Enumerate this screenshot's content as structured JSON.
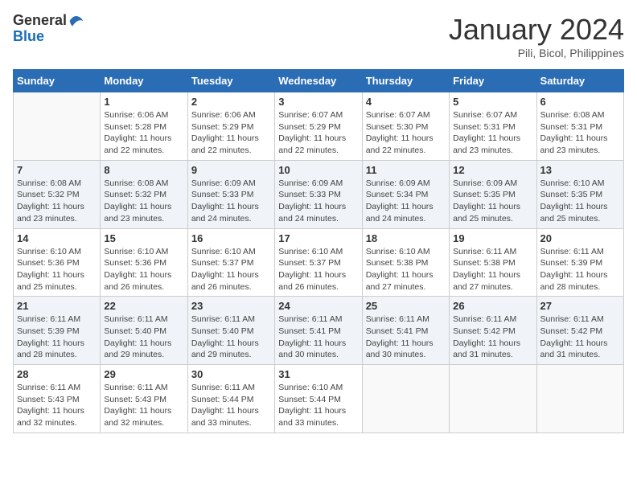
{
  "logo": {
    "general": "General",
    "blue": "Blue"
  },
  "title": "January 2024",
  "subtitle": "Pili, Bicol, Philippines",
  "days_of_week": [
    "Sunday",
    "Monday",
    "Tuesday",
    "Wednesday",
    "Thursday",
    "Friday",
    "Saturday"
  ],
  "weeks": [
    [
      {
        "day": "",
        "info": ""
      },
      {
        "day": "1",
        "info": "Sunrise: 6:06 AM\nSunset: 5:28 PM\nDaylight: 11 hours and 22 minutes."
      },
      {
        "day": "2",
        "info": "Sunrise: 6:06 AM\nSunset: 5:29 PM\nDaylight: 11 hours and 22 minutes."
      },
      {
        "day": "3",
        "info": "Sunrise: 6:07 AM\nSunset: 5:29 PM\nDaylight: 11 hours and 22 minutes."
      },
      {
        "day": "4",
        "info": "Sunrise: 6:07 AM\nSunset: 5:30 PM\nDaylight: 11 hours and 22 minutes."
      },
      {
        "day": "5",
        "info": "Sunrise: 6:07 AM\nSunset: 5:31 PM\nDaylight: 11 hours and 23 minutes."
      },
      {
        "day": "6",
        "info": "Sunrise: 6:08 AM\nSunset: 5:31 PM\nDaylight: 11 hours and 23 minutes."
      }
    ],
    [
      {
        "day": "7",
        "info": "Sunrise: 6:08 AM\nSunset: 5:32 PM\nDaylight: 11 hours and 23 minutes."
      },
      {
        "day": "8",
        "info": "Sunrise: 6:08 AM\nSunset: 5:32 PM\nDaylight: 11 hours and 23 minutes."
      },
      {
        "day": "9",
        "info": "Sunrise: 6:09 AM\nSunset: 5:33 PM\nDaylight: 11 hours and 24 minutes."
      },
      {
        "day": "10",
        "info": "Sunrise: 6:09 AM\nSunset: 5:33 PM\nDaylight: 11 hours and 24 minutes."
      },
      {
        "day": "11",
        "info": "Sunrise: 6:09 AM\nSunset: 5:34 PM\nDaylight: 11 hours and 24 minutes."
      },
      {
        "day": "12",
        "info": "Sunrise: 6:09 AM\nSunset: 5:35 PM\nDaylight: 11 hours and 25 minutes."
      },
      {
        "day": "13",
        "info": "Sunrise: 6:10 AM\nSunset: 5:35 PM\nDaylight: 11 hours and 25 minutes."
      }
    ],
    [
      {
        "day": "14",
        "info": "Sunrise: 6:10 AM\nSunset: 5:36 PM\nDaylight: 11 hours and 25 minutes."
      },
      {
        "day": "15",
        "info": "Sunrise: 6:10 AM\nSunset: 5:36 PM\nDaylight: 11 hours and 26 minutes."
      },
      {
        "day": "16",
        "info": "Sunrise: 6:10 AM\nSunset: 5:37 PM\nDaylight: 11 hours and 26 minutes."
      },
      {
        "day": "17",
        "info": "Sunrise: 6:10 AM\nSunset: 5:37 PM\nDaylight: 11 hours and 26 minutes."
      },
      {
        "day": "18",
        "info": "Sunrise: 6:10 AM\nSunset: 5:38 PM\nDaylight: 11 hours and 27 minutes."
      },
      {
        "day": "19",
        "info": "Sunrise: 6:11 AM\nSunset: 5:38 PM\nDaylight: 11 hours and 27 minutes."
      },
      {
        "day": "20",
        "info": "Sunrise: 6:11 AM\nSunset: 5:39 PM\nDaylight: 11 hours and 28 minutes."
      }
    ],
    [
      {
        "day": "21",
        "info": "Sunrise: 6:11 AM\nSunset: 5:39 PM\nDaylight: 11 hours and 28 minutes."
      },
      {
        "day": "22",
        "info": "Sunrise: 6:11 AM\nSunset: 5:40 PM\nDaylight: 11 hours and 29 minutes."
      },
      {
        "day": "23",
        "info": "Sunrise: 6:11 AM\nSunset: 5:40 PM\nDaylight: 11 hours and 29 minutes."
      },
      {
        "day": "24",
        "info": "Sunrise: 6:11 AM\nSunset: 5:41 PM\nDaylight: 11 hours and 30 minutes."
      },
      {
        "day": "25",
        "info": "Sunrise: 6:11 AM\nSunset: 5:41 PM\nDaylight: 11 hours and 30 minutes."
      },
      {
        "day": "26",
        "info": "Sunrise: 6:11 AM\nSunset: 5:42 PM\nDaylight: 11 hours and 31 minutes."
      },
      {
        "day": "27",
        "info": "Sunrise: 6:11 AM\nSunset: 5:42 PM\nDaylight: 11 hours and 31 minutes."
      }
    ],
    [
      {
        "day": "28",
        "info": "Sunrise: 6:11 AM\nSunset: 5:43 PM\nDaylight: 11 hours and 32 minutes."
      },
      {
        "day": "29",
        "info": "Sunrise: 6:11 AM\nSunset: 5:43 PM\nDaylight: 11 hours and 32 minutes."
      },
      {
        "day": "30",
        "info": "Sunrise: 6:11 AM\nSunset: 5:44 PM\nDaylight: 11 hours and 33 minutes."
      },
      {
        "day": "31",
        "info": "Sunrise: 6:10 AM\nSunset: 5:44 PM\nDaylight: 11 hours and 33 minutes."
      },
      {
        "day": "",
        "info": ""
      },
      {
        "day": "",
        "info": ""
      },
      {
        "day": "",
        "info": ""
      }
    ]
  ]
}
